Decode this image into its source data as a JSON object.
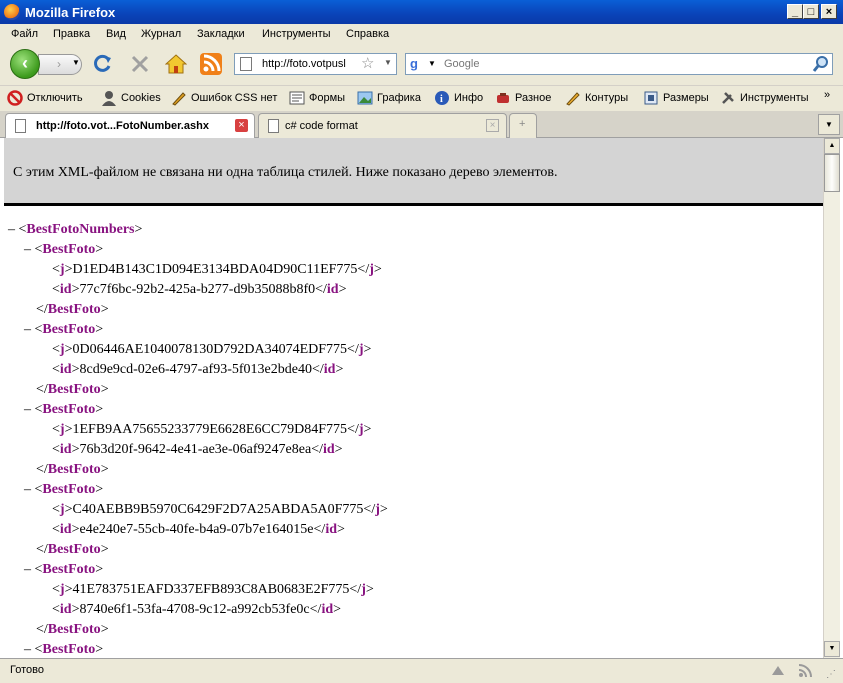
{
  "window": {
    "title": "Mozilla Firefox"
  },
  "menu": [
    "Файл",
    "Правка",
    "Вид",
    "Журнал",
    "Закладки",
    "Инструменты",
    "Справка"
  ],
  "nav": {
    "url": "http://foto.votpusl",
    "search_placeholder": "Google"
  },
  "addons": [
    "Отключить",
    "Cookies",
    "Ошибок CSS нет",
    "Формы",
    "Графика",
    "Инфо",
    "Разное",
    "Контуры",
    "Размеры",
    "Инструменты"
  ],
  "tabs": [
    {
      "label": "http://foto.vot...FotoNumber.ashx"
    },
    {
      "label": "c# code format"
    }
  ],
  "content": {
    "info": "С этим XML-файлом не связана ни одна таблица стилей. Ниже показано дерево элементов.",
    "root_tag": "BestFotoNumbers",
    "item_tag": "BestFoto",
    "j_tag": "j",
    "id_tag": "id",
    "items": [
      {
        "j": "D1ED4B143C1D094E3134BDA04D90C11EF775",
        "id": "77c7f6bc-92b2-425a-b277-d9b35088b8f0"
      },
      {
        "j": "0D06446AE1040078130D792DA34074EDF775",
        "id": "8cd9e9cd-02e6-4797-af93-5f013e2bde40"
      },
      {
        "j": "1EFB9AA75655233779E6628E6CC79D84F775",
        "id": "76b3d20f-9642-4e41-ae3e-06af9247e8ea"
      },
      {
        "j": "C40AEBB9B5970C6429F2D7A25ABDA5A0F775",
        "id": "e4e240e7-55cb-40fe-b4a9-07b7e164015e"
      },
      {
        "j": "41E783751EAFD337EFB893C8AB0683E2F775",
        "id": "8740e6f1-53fa-4708-9c12-a992cb53fe0c"
      }
    ]
  },
  "status": "Готово"
}
